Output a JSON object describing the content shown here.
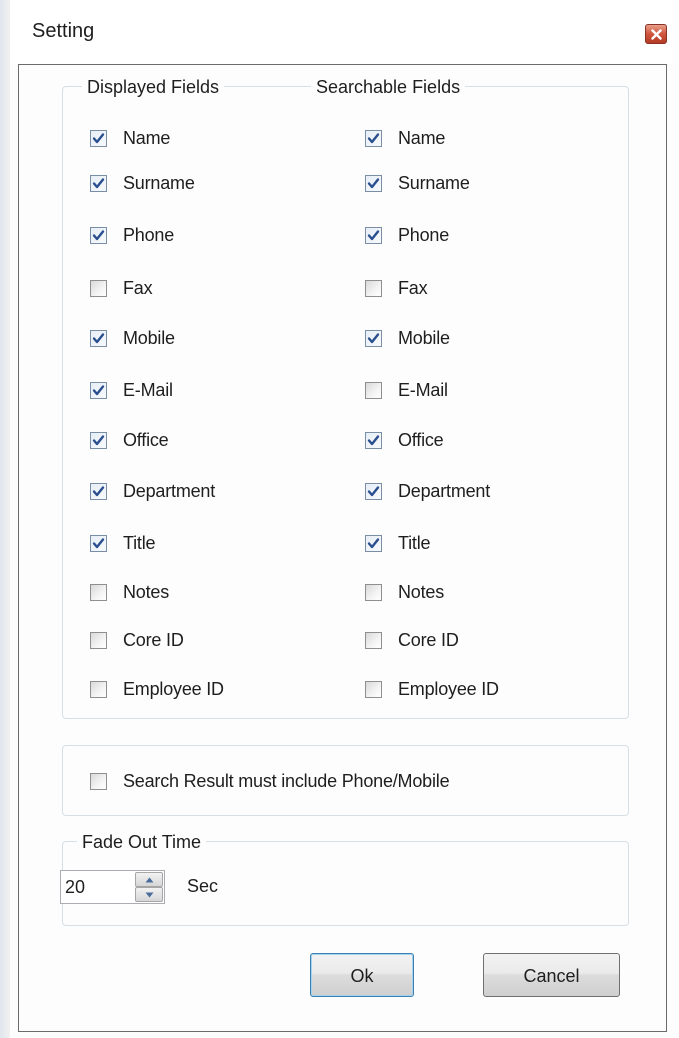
{
  "window": {
    "title": "Setting"
  },
  "displayed_fields": {
    "legend": "Displayed Fields",
    "items": [
      {
        "label": "Name",
        "checked": true
      },
      {
        "label": "Surname",
        "checked": true
      },
      {
        "label": "Phone",
        "checked": true
      },
      {
        "label": "Fax",
        "checked": false
      },
      {
        "label": "Mobile",
        "checked": true
      },
      {
        "label": "E-Mail",
        "checked": true
      },
      {
        "label": "Office",
        "checked": true
      },
      {
        "label": "Department",
        "checked": true
      },
      {
        "label": "Title",
        "checked": true
      },
      {
        "label": "Notes",
        "checked": false
      },
      {
        "label": "Core ID",
        "checked": false
      },
      {
        "label": "Employee ID",
        "checked": false
      }
    ]
  },
  "searchable_fields": {
    "legend": "Searchable Fields",
    "items": [
      {
        "label": "Name",
        "checked": true
      },
      {
        "label": "Surname",
        "checked": true
      },
      {
        "label": "Phone",
        "checked": true
      },
      {
        "label": "Fax",
        "checked": false
      },
      {
        "label": "Mobile",
        "checked": true
      },
      {
        "label": "E-Mail",
        "checked": false
      },
      {
        "label": "Office",
        "checked": true
      },
      {
        "label": "Department",
        "checked": true
      },
      {
        "label": "Title",
        "checked": true
      },
      {
        "label": "Notes",
        "checked": false
      },
      {
        "label": "Core ID",
        "checked": false
      },
      {
        "label": "Employee ID",
        "checked": false
      }
    ]
  },
  "search_option": {
    "label": "Search Result must include Phone/Mobile",
    "checked": false
  },
  "fade_out": {
    "legend": "Fade Out Time",
    "value": "20",
    "unit": "Sec"
  },
  "buttons": {
    "ok": "Ok",
    "cancel": "Cancel"
  },
  "colors": {
    "check_mark": "#2a4f8e",
    "group_border": "#d5dfe5",
    "close_button": "#c7452c"
  }
}
